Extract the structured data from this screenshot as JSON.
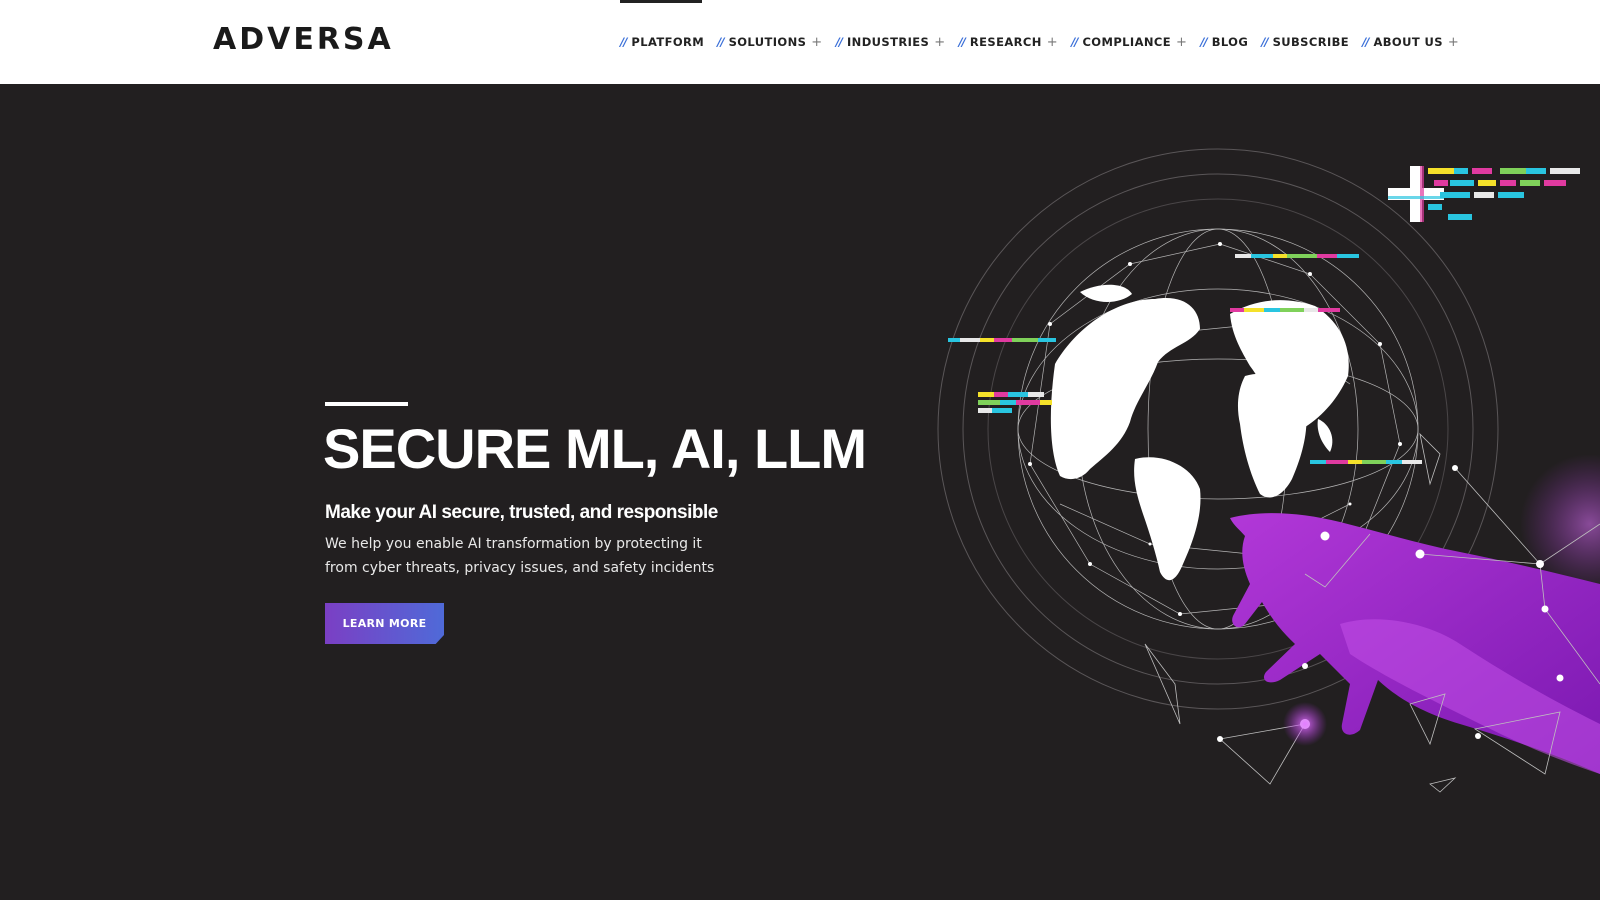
{
  "brand": {
    "logo_text": "ADVERSA"
  },
  "nav": {
    "items": [
      {
        "label": "PLATFORM",
        "has_submenu": false,
        "active": true
      },
      {
        "label": "SOLUTIONS",
        "has_submenu": true
      },
      {
        "label": "INDUSTRIES",
        "has_submenu": true
      },
      {
        "label": "RESEARCH",
        "has_submenu": true
      },
      {
        "label": "COMPLIANCE",
        "has_submenu": true
      },
      {
        "label": "BLOG",
        "has_submenu": false
      },
      {
        "label": "SUBSCRIBE",
        "has_submenu": false
      },
      {
        "label": "ABOUT US",
        "has_submenu": true
      }
    ],
    "separator": "//",
    "submenu_marker": "+"
  },
  "hero": {
    "title": "SECURE ML, AI, LLM",
    "subtitle": "Make your AI secure, trusted, and responsible",
    "description_line1": "We help you enable AI transformation by protecting it",
    "description_line2": "from cyber threats, privacy issues, and safety incidents",
    "cta_label": "LEARN MORE"
  },
  "colors": {
    "background": "#221f20",
    "header": "#ffffff",
    "accent_blue": "#3a6fd8",
    "accent_purple": "#8e2bc7",
    "cta_gradient_start": "#7b3fc4",
    "cta_gradient_end": "#4f6ad8"
  },
  "illustration": {
    "icons": [
      "globe-icon",
      "network-mesh-icon",
      "hand-icon",
      "glitch-bars-icon",
      "plus-icon"
    ]
  }
}
